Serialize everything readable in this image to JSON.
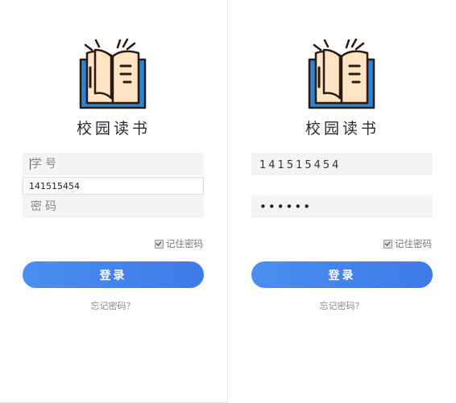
{
  "app": {
    "title": "校园读书"
  },
  "left_screen": {
    "student_id_placeholder": "学号",
    "student_id_value": "",
    "autocomplete_suggestion": "141515454",
    "password_placeholder": "密码",
    "password_value": "",
    "remember_label": "记住密码",
    "remember_checked": true,
    "login_label": "登录",
    "forgot_label": "忘记密码？"
  },
  "right_screen": {
    "student_id_value": "141515454",
    "password_value": "••••••",
    "remember_label": "记住密码",
    "remember_checked": true,
    "login_label": "登录",
    "forgot_label": "忘记密码？"
  },
  "colors": {
    "accent": "#4285f4",
    "field_bg": "#f4f4f4",
    "book_cover": "#2b86d6",
    "book_pages": "#ffe4c4",
    "book_outline": "#2a1a14"
  },
  "icons": {
    "logo": "open-book-icon",
    "checkbox": "checkbox-icon"
  }
}
